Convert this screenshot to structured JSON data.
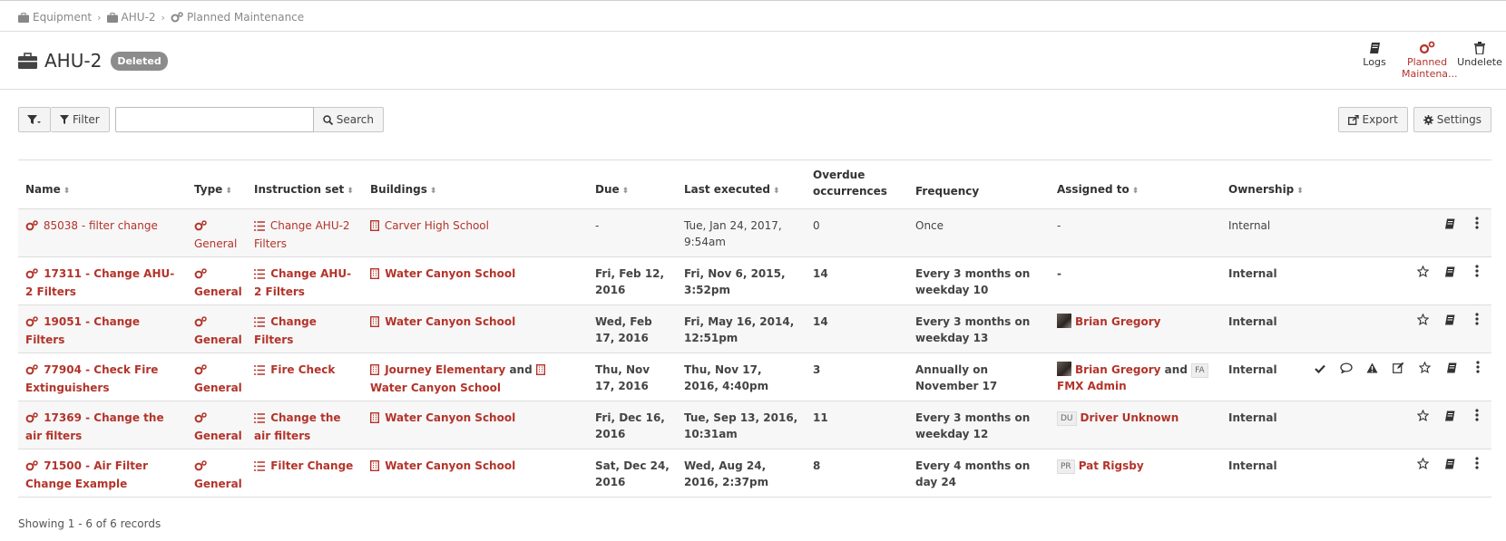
{
  "breadcrumb": [
    "Equipment",
    "AHU-2",
    "Planned Maintenance"
  ],
  "header": {
    "title": "AHU-2",
    "badge": "Deleted"
  },
  "header_actions": [
    {
      "label": "Logs",
      "icon": "book-icon"
    },
    {
      "label": "Planned Maintena...",
      "icon": "cogs-icon"
    },
    {
      "label": "Undelete",
      "icon": "trash-icon"
    }
  ],
  "toolbar": {
    "filter_label": "Filter",
    "search_value": "",
    "search_label": "Search",
    "export_label": "Export",
    "settings_label": "Settings"
  },
  "columns": [
    "Name",
    "Type",
    "Instruction set",
    "Buildings",
    "Due",
    "Last executed",
    "Overdue occurrences",
    "Frequency",
    "Assigned to",
    "Ownership"
  ],
  "rows": [
    {
      "name": "85038 - filter change",
      "type": "General",
      "instruction": "Change AHU-2 Filters",
      "buildings": [
        "Carver High School"
      ],
      "due": "-",
      "last": "Tue, Jan 24, 2017, 9:54am",
      "overdue": "0",
      "frequency": "Once",
      "assigned": [],
      "assigned_none": "-",
      "ownership": "Internal",
      "actions": [
        "book-icon",
        "more-icon"
      ],
      "bold": false
    },
    {
      "name": "17311 - Change AHU-2 Filters",
      "type": "General",
      "instruction": "Change AHU-2 Filters",
      "buildings": [
        "Water Canyon School"
      ],
      "due": "Fri, Feb 12, 2016",
      "last": "Fri, Nov 6, 2015, 3:52pm",
      "overdue": "14",
      "frequency": "Every 3 months on weekday 10",
      "assigned": [],
      "assigned_none": "-",
      "ownership": "Internal",
      "actions": [
        "star-icon",
        "book-icon",
        "more-icon"
      ],
      "bold": true
    },
    {
      "name": "19051 - Change Filters",
      "type": "General",
      "instruction": "Change Filters",
      "buildings": [
        "Water Canyon School"
      ],
      "due": "Wed, Feb 17, 2016",
      "last": "Fri, May 16, 2014, 12:51pm",
      "overdue": "14",
      "frequency": "Every 3 months on weekday 13",
      "assigned": [
        {
          "kind": "avatar",
          "name": "Brian Gregory"
        }
      ],
      "ownership": "Internal",
      "actions": [
        "star-icon",
        "book-icon",
        "more-icon"
      ],
      "bold": true
    },
    {
      "name": "77904 - Check Fire Extinguishers",
      "type": "General",
      "instruction": "Fire Check",
      "buildings": [
        "Journey Elementary",
        "Water Canyon School"
      ],
      "buildings_joiner": "and",
      "due": "Thu, Nov 17, 2016",
      "last": "Thu, Nov 17, 2016, 4:40pm",
      "overdue": "3",
      "frequency": "Annually on November 17",
      "assigned": [
        {
          "kind": "avatar",
          "name": "Brian Gregory"
        },
        {
          "kind": "initials",
          "initials": "FA",
          "name": "FMX Admin"
        }
      ],
      "assigned_joiner": "and",
      "ownership": "Internal",
      "actions": [
        "check-icon",
        "comment-icon",
        "warning-icon",
        "edit-icon",
        "star-icon",
        "book-icon",
        "more-icon"
      ],
      "bold": true
    },
    {
      "name": "17369 - Change the air filters",
      "type": "General",
      "instruction": "Change the air filters",
      "buildings": [
        "Water Canyon School"
      ],
      "due": "Fri, Dec 16, 2016",
      "last": "Tue, Sep 13, 2016, 10:31am",
      "overdue": "11",
      "frequency": "Every 3 months on weekday 12",
      "assigned": [
        {
          "kind": "initials",
          "initials": "DU",
          "name": "Driver Unknown"
        }
      ],
      "ownership": "Internal",
      "actions": [
        "star-icon",
        "book-icon",
        "more-icon"
      ],
      "bold": true
    },
    {
      "name": "71500 - Air Filter Change Example",
      "type": "General",
      "instruction": "Filter Change",
      "buildings": [
        "Water Canyon School"
      ],
      "due": "Sat, Dec 24, 2016",
      "last": "Wed, Aug 24, 2016, 2:37pm",
      "overdue": "8",
      "frequency": "Every 4 months on day 24",
      "assigned": [
        {
          "kind": "initials",
          "initials": "PR",
          "name": "Pat Rigsby"
        }
      ],
      "ownership": "Internal",
      "actions": [
        "star-icon",
        "book-icon",
        "more-icon"
      ],
      "bold": true
    }
  ],
  "footer": "Showing 1 - 6 of 6 records",
  "colors": {
    "link": "#b3342a",
    "badge": "#8c8c8c"
  }
}
